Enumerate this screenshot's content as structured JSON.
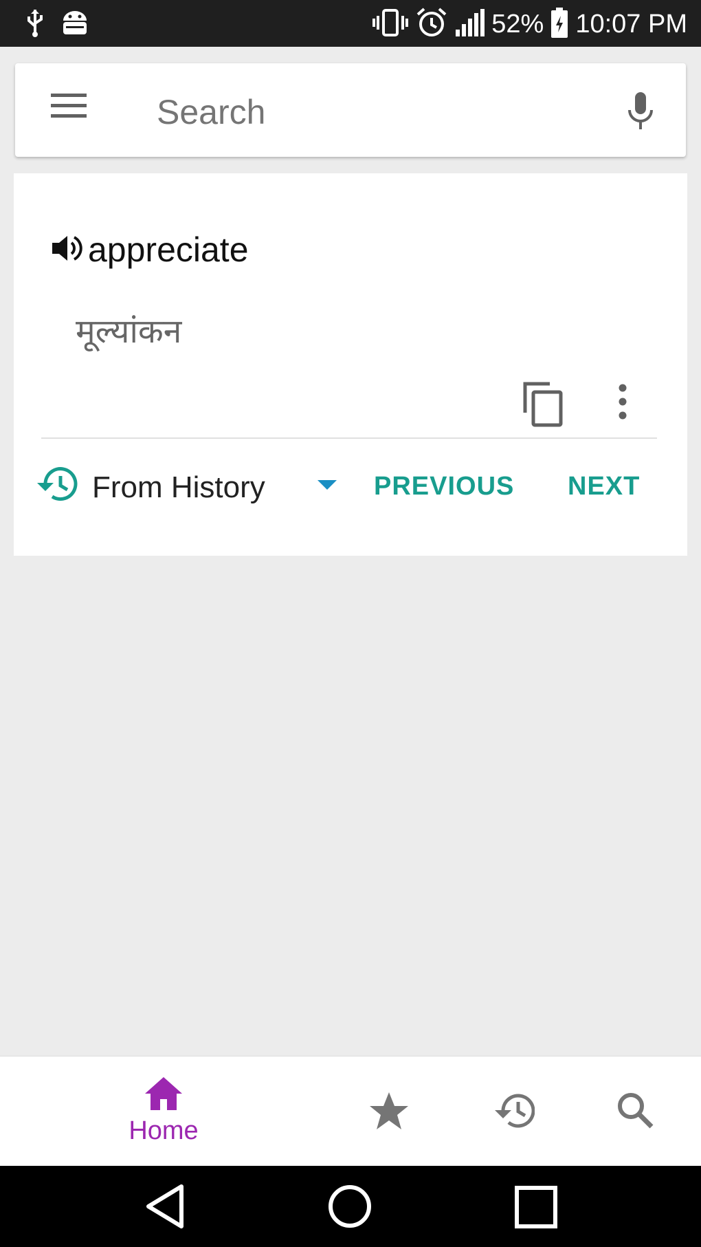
{
  "status_bar": {
    "battery_percent": "52%",
    "time": "10:07 PM",
    "left_icons": [
      "usb-icon",
      "android-icon"
    ],
    "right_icons": [
      "vibrate-icon",
      "alarm-icon",
      "signal-icon",
      "battery-icon"
    ]
  },
  "search": {
    "placeholder": "Search",
    "menu_icon": "hamburger-menu-icon",
    "mic_icon": "microphone-icon"
  },
  "card": {
    "word": "appreciate",
    "translation": "मूल्यांकन",
    "speaker_icon": "speaker-icon",
    "copy_icon": "copy-icon",
    "more_icon": "more-vert-icon",
    "history_label": "From History",
    "previous_label": "PREVIOUS",
    "next_label": "NEXT"
  },
  "bottom_nav": {
    "home_label": "Home",
    "items": [
      "home-icon",
      "star-icon",
      "history-icon",
      "search-icon"
    ]
  },
  "colors": {
    "accent_teal": "#189d8e",
    "accent_purple": "#9c27b0",
    "dropdown_blue": "#1a8fc4",
    "status_bar_bg": "#1f1f1f",
    "page_bg": "#ececec"
  }
}
